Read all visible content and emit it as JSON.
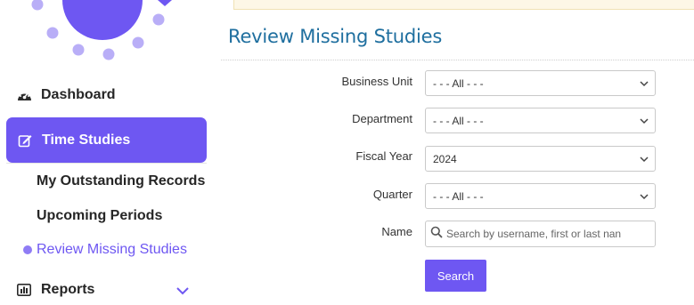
{
  "sidebar": {
    "dashboard_label": "Dashboard",
    "active_label": "Time Studies",
    "sub_items": [
      {
        "label": "My Outstanding Records"
      },
      {
        "label": "Upcoming Periods"
      },
      {
        "label": "Review Missing Studies"
      }
    ],
    "reports_label": "Reports",
    "icons": {
      "dashboard": "speedometer-icon",
      "time_studies": "edit-note-icon",
      "reports": "bar-chart-icon",
      "reports_toggle": "chevron-down-icon"
    }
  },
  "main": {
    "title": "Review Missing Studies",
    "form": {
      "business_unit": {
        "label": "Business Unit",
        "value": "- - - All - - -"
      },
      "department": {
        "label": "Department",
        "value": "- - - All - - -"
      },
      "fiscal_year": {
        "label": "Fiscal Year",
        "value": "2024"
      },
      "quarter": {
        "label": "Quarter",
        "value": "- - - All - - -"
      },
      "name": {
        "label": "Name",
        "placeholder": "Search by username, first or last nan"
      },
      "search_button": "Search"
    }
  },
  "colors": {
    "accent": "#6e57f2",
    "title": "#1f6f9f",
    "banner": "#fdf7e6"
  }
}
